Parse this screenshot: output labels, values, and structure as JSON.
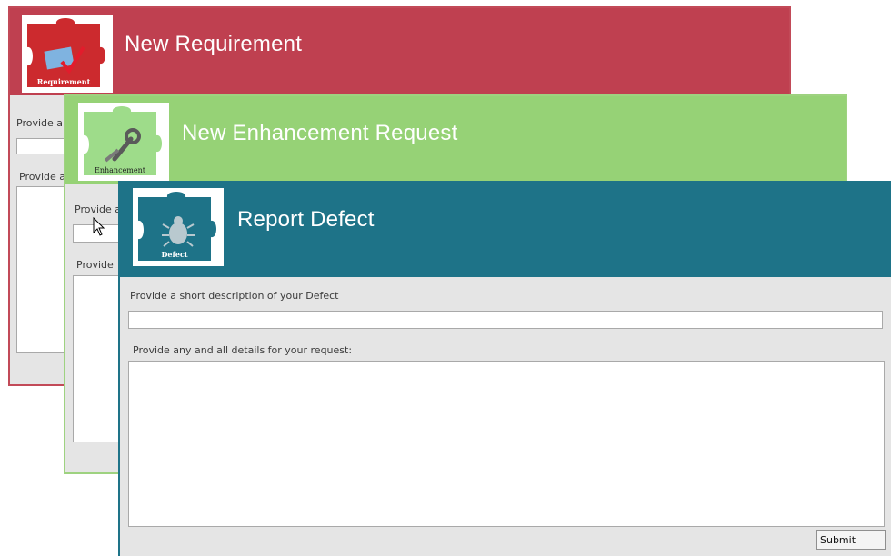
{
  "requirement": {
    "title": "New Requirement",
    "logo_text": "Requirement",
    "short_desc_label": "Provide a",
    "details_label": "Provide a",
    "header_color": "#bf4050",
    "icon": "requirement-puzzle-icon"
  },
  "enhancement": {
    "title": "New Enhancement Request",
    "logo_text": "Enhancement",
    "short_desc_label": "Provide a",
    "details_label": "Provide",
    "header_color": "#96d276",
    "icon": "enhancement-puzzle-icon"
  },
  "defect": {
    "title": "Report Defect",
    "logo_text": "Defect",
    "short_desc_label": "Provide a short description of your Defect",
    "details_label": "Provide any and all details for your request:",
    "submit_label": "Submit",
    "header_color": "#1e7388",
    "icon": "defect-puzzle-icon"
  }
}
